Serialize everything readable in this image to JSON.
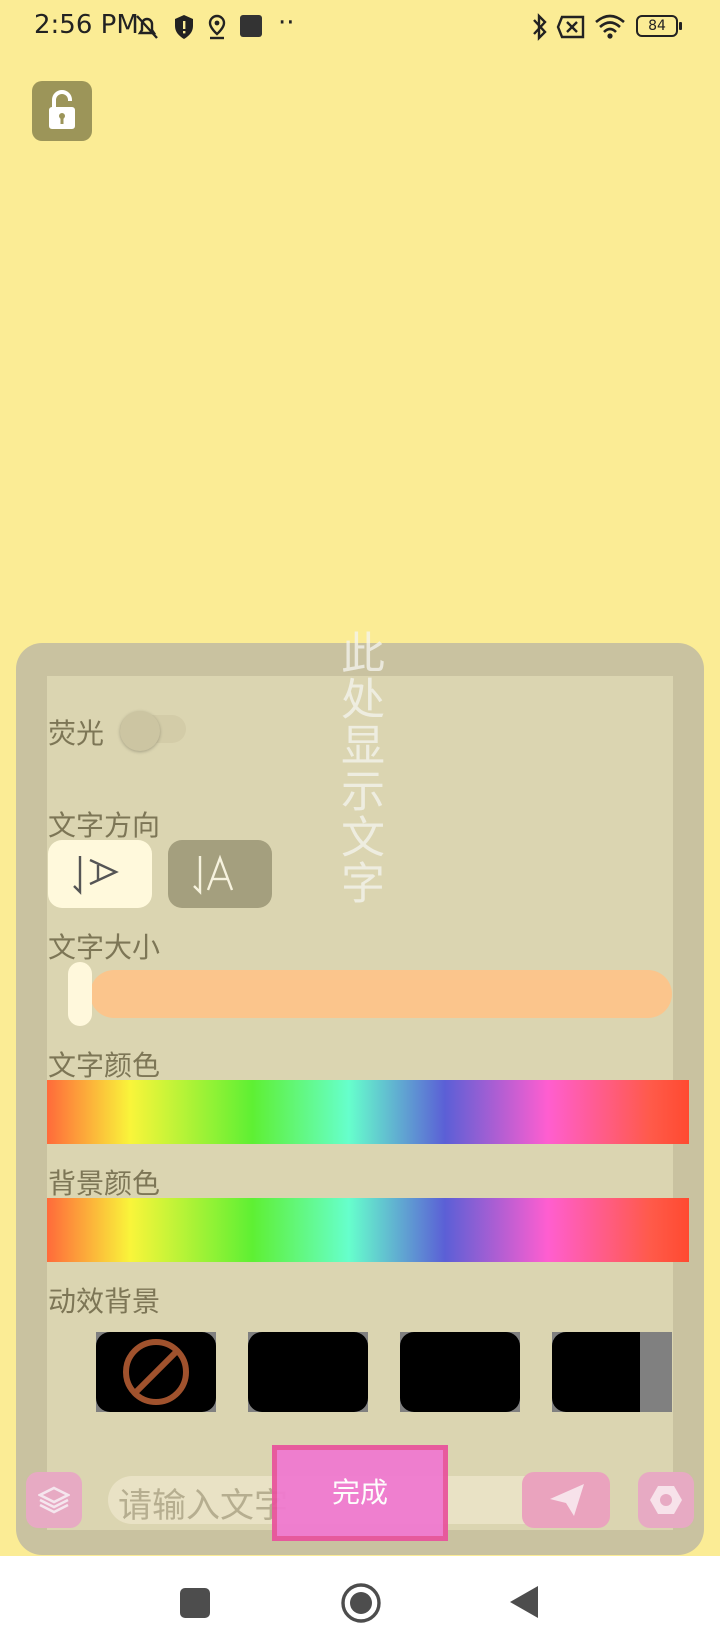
{
  "status_bar": {
    "time": "2:56 PM",
    "dots": "··",
    "battery": "84"
  },
  "display_text": "此处显示文字",
  "panel": {
    "fluorescent_label": "荧光",
    "direction_label": "文字方向",
    "size_label": "文字大小",
    "text_color_label": "文字颜色",
    "bg_color_label": "背景颜色",
    "anim_bg_label": "动效背景"
  },
  "toggle": {
    "fluorescent_on": false
  },
  "slider": {
    "text_size_fraction": 0.0
  },
  "input": {
    "placeholder": "请输入文字"
  },
  "done_button": "完成",
  "colors": {
    "background": "#fbec95",
    "panel": "#dbd5b1",
    "accent_orange": "#fbc58c",
    "done_pink": "#f07ad0"
  },
  "icons": [
    "lock-open-icon",
    "send-icon",
    "layers-icon",
    "settings-icon",
    "no-animation-icon"
  ]
}
